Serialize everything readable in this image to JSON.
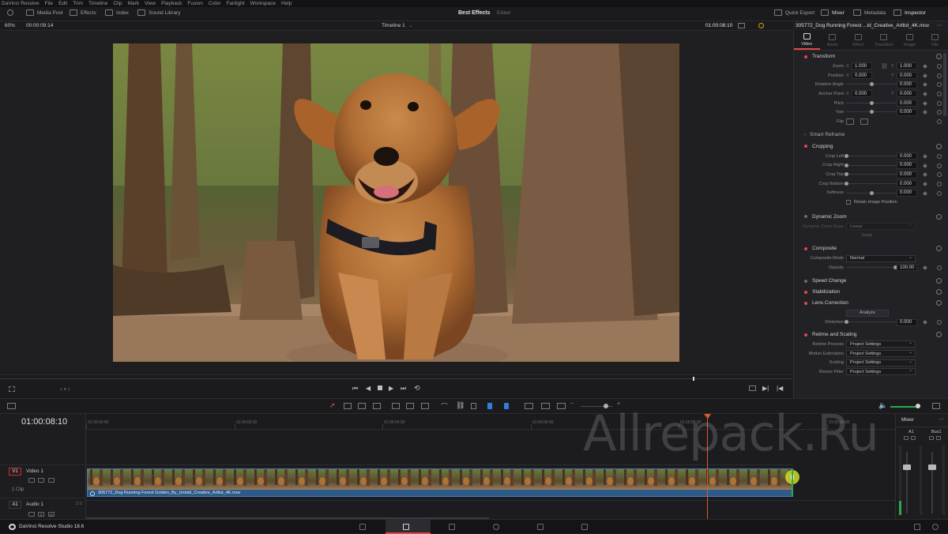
{
  "menu": [
    "DaVinci Resolve",
    "File",
    "Edit",
    "Trim",
    "Timeline",
    "Clip",
    "Mark",
    "View",
    "Playback",
    "Fusion",
    "Color",
    "Fairlight",
    "Workspace",
    "Help"
  ],
  "toolbar": {
    "media_pool": "Media Pool",
    "effects": "Effects",
    "index": "Index",
    "sound_library": "Sound Library",
    "project_title": "Best Effects",
    "edited": "Edited",
    "quick_export": "Quick Export",
    "mixer": "Mixer",
    "metadata": "Metadata",
    "inspector": "Inspector"
  },
  "viewer": {
    "zoom": "60%",
    "timecode_left": "00:00:09:14",
    "timeline_name": "Timeline 1",
    "timecode_right": "01:00:08:10",
    "clip_name": "305772_Dog Running Forest ...ld_Creative_Artlist_4K.mov"
  },
  "inspector": {
    "tabs": [
      "Video",
      "Audio",
      "Effect",
      "Transition",
      "Image",
      "File"
    ],
    "active_tab": "Video",
    "transform": {
      "title": "Transform",
      "zoom_label": "Zoom",
      "zoom_x": "1.000",
      "zoom_y": "1.000",
      "position_label": "Position",
      "position_x": "0.000",
      "position_y": "0.000",
      "rotation_label": "Rotation Angle",
      "rotation": "0.000",
      "anchor_label": "Anchor Point",
      "anchor_x": "0.000",
      "anchor_y": "0.000",
      "pitch_label": "Pitch",
      "pitch": "0.000",
      "yaw_label": "Yaw",
      "yaw": "0.000",
      "flip_label": "Flip",
      "x": "X",
      "y": "Y"
    },
    "smart_reframe": "Smart Reframe",
    "cropping": {
      "title": "Cropping",
      "left_label": "Crop Left",
      "left": "0.000",
      "right_label": "Crop Right",
      "right": "0.000",
      "top_label": "Crop Top",
      "top": "0.000",
      "bottom_label": "Crop Bottom",
      "bottom": "0.000",
      "softness_label": "Softness",
      "softness": "0.000",
      "retain_label": "Retain Image Position"
    },
    "dynamic_zoom": {
      "title": "Dynamic Zoom",
      "ease_label": "Dynamic Zoom Ease",
      "ease_value": "Linear",
      "swap": "Swap"
    },
    "composite": {
      "title": "Composite",
      "mode_label": "Composite Mode",
      "mode": "Normal",
      "opacity_label": "Opacity",
      "opacity": "100.00"
    },
    "speed_change": "Speed Change",
    "stabilization": "Stabilization",
    "lens_correction": {
      "title": "Lens Correction",
      "analyze": "Analyze",
      "distortion_label": "Distortion",
      "distortion": "0.000"
    },
    "retime": {
      "title": "Retime and Scaling",
      "process_label": "Retime Process",
      "process": "Project Settings",
      "motion_label": "Motion Estimation",
      "motion": "Project Settings",
      "scaling_label": "Scaling",
      "scaling": "Project Settings",
      "resize_label": "Resize Filter",
      "resize": "Project Settings"
    }
  },
  "timeline": {
    "timecode": "01:00:08:10",
    "ruler": [
      "01:00:00:00",
      "01:00:02:00",
      "01:00:04:00",
      "01:00:06:00",
      "01:00:08:00",
      "01:00:10:00"
    ],
    "playhead_fraction": 0.769,
    "video_track": {
      "id": "V1",
      "name": "Video 1",
      "count": "1 Clip"
    },
    "audio_track": {
      "id": "A1",
      "name": "Audio 1",
      "channels": "2.0"
    },
    "clip_label": "305772_Dog Running Forest Golden_By_Untold_Creative_Artlist_4K.mov"
  },
  "mixer": {
    "title": "Mixer",
    "ch1": "A1",
    "ch2": "Bus1"
  },
  "status": {
    "app": "DaVinci Resolve Studio 18.6"
  },
  "watermark": "Allrepack.Ru"
}
